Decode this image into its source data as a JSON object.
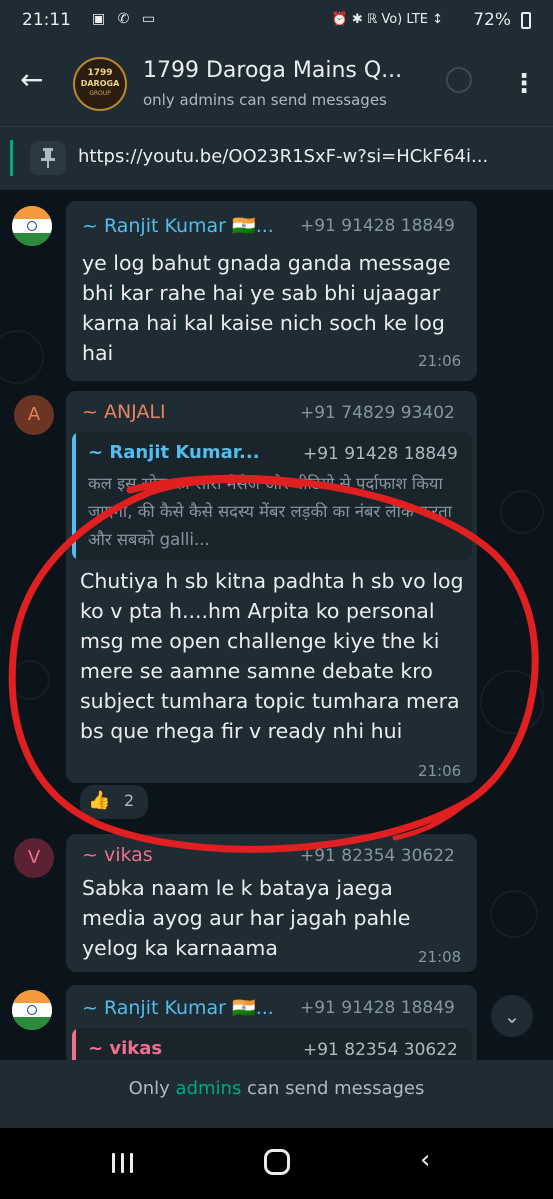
{
  "status_bar": {
    "time": "21:11",
    "left_icons": "▣ ✆ ▭",
    "right_icons": "⏰ ✱ ℝ Vo) LTE ↕",
    "battery": "72%"
  },
  "header": {
    "title": "1799 Daroga Mains Q...",
    "subtitle": "only admins can send messages",
    "avatar_lines": [
      "1799",
      "DAROGA",
      "GROUP"
    ]
  },
  "pinned": {
    "text": "https://youtu.be/OO23R1SxF-w?si=HCkF64i..."
  },
  "messages": [
    {
      "sender": "~ Ranjit Kumar 🇮🇳...",
      "phone": "+91 91428 18849",
      "text": "ye log bahut gnada ganda message bhi kar rahe hai ye sab bhi ujaagar karna hai kal kaise nich soch ke log hai",
      "time": "21:06",
      "sender_color": "#53bdeb"
    },
    {
      "avatar_letter": "A",
      "sender": "~ ANJALI",
      "phone": "+91 74829 93402",
      "quote": {
        "sender": "~ Ranjit Kumar...",
        "phone": "+91 91428 18849",
        "text": "कल इस सोच का सारा मैसेज और वीडियो से पर्दाफाश किया जाएगा, की कैसे कैसे सदस्य मेंबर लड़की का नंबर लीक करता और सबको galli..."
      },
      "text": "Chutiya h sb kitna padhta h sb vo log ko v pta h....hm Arpita ko personal msg me open challenge kiye the ki mere se aamne samne debate kro subject tumhara topic tumhara mera bs que rhega fir v ready nhi hui",
      "time": "21:06",
      "reaction_emoji": "👍",
      "reaction_count": "2",
      "sender_color": "#e6835a"
    },
    {
      "avatar_letter": "V",
      "sender": "~ vikas",
      "phone": "+91 82354 30622",
      "text": "Sabka naam le k bataya jaega media ayog aur har jagah pahle yelog ka karnaama",
      "time": "21:08",
      "sender_color": "#ef6f8f"
    },
    {
      "sender": "~ Ranjit Kumar 🇮🇳...",
      "phone": "+91 91428 18849",
      "quote": {
        "sender": "~ vikas",
        "phone": "+91 82354 30622"
      },
      "sender_color": "#53bdeb"
    }
  ],
  "footer": {
    "prefix": "Only ",
    "link": "admins",
    "suffix": " can send messages"
  },
  "colors": {
    "accent": "#00a884",
    "annotation_red": "#e02020",
    "bubble": "#202c33",
    "background": "#0b141a"
  },
  "icons": {
    "back": "←",
    "pin": "⊥",
    "kebab": "⋮",
    "scroll_down": "⌄",
    "nav_back": "‹"
  }
}
